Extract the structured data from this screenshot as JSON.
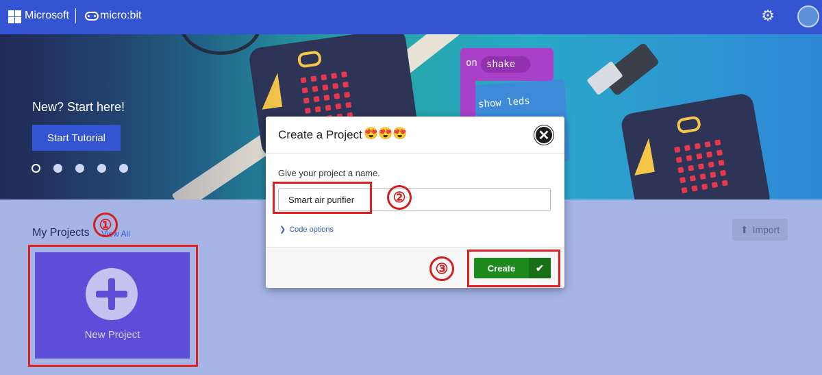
{
  "topbar": {
    "brand": "Microsoft",
    "product": "micro:bit",
    "settings_icon": "gear-icon",
    "avatar_icon": "user-avatar"
  },
  "hero": {
    "title": "New? Start here!",
    "start_button": "Start Tutorial",
    "carousel_count": 5,
    "carousel_active": 0,
    "image_text": {
      "event_block": "on",
      "event_value": "shake",
      "action_block": "show leds"
    }
  },
  "projects": {
    "title": "My Projects",
    "view_all": "View All",
    "import_button": "Import",
    "new_project_label": "New Project"
  },
  "dialog": {
    "title": "Create a Project",
    "emojis": "😍😍😍",
    "prompt": "Give your project a name.",
    "name_value": "Smart air purifier",
    "code_options": "Code options",
    "create_button": "Create"
  },
  "annotations": {
    "step1": "①",
    "step2": "②",
    "step3": "③",
    "highlight_color": "#e02020"
  },
  "colors": {
    "brand_blue": "#3454d1",
    "create_green": "#1d8a1d",
    "new_project_purple": "#5c4ed6"
  }
}
